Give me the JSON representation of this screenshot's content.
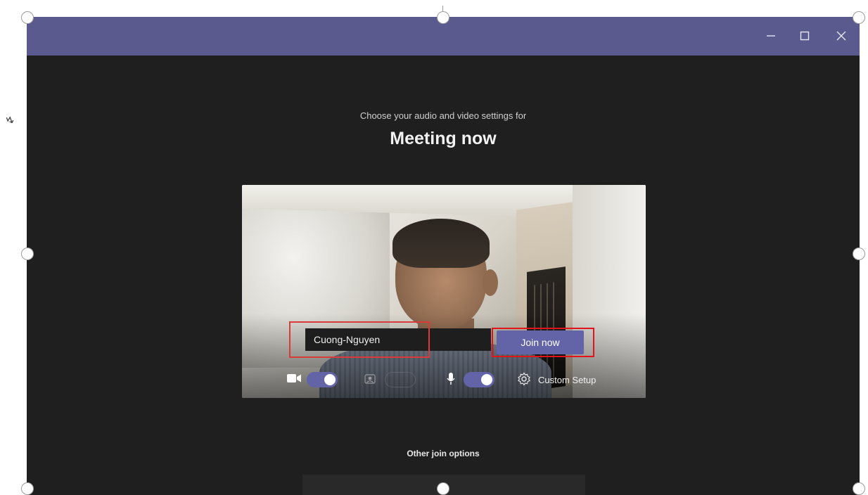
{
  "window": {
    "controls": {
      "minimize": "minimize-icon",
      "maximize": "maximize-icon",
      "close": "close-icon"
    }
  },
  "prejoin": {
    "subtitle": "Choose your audio and video settings for",
    "meeting_title": "Meeting now",
    "name_value": "Cuong-Nguyen",
    "join_label": "Join now",
    "custom_setup_label": "Custom Setup",
    "camera_on": true,
    "background_blur_on": false,
    "mic_on": true,
    "other_options_label": "Other join options"
  },
  "colors": {
    "titlebar": "#5b5a8f",
    "app_background": "#201f1f",
    "accent": "#6264a7",
    "highlight_red": "#e0141a"
  }
}
